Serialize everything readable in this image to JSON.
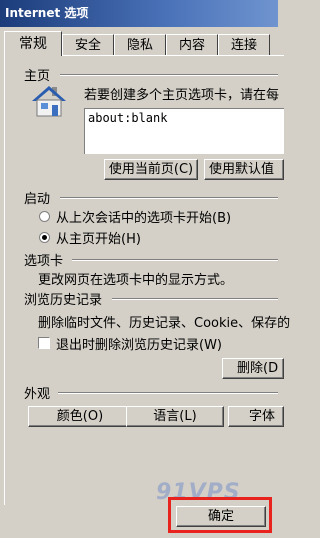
{
  "window": {
    "title": "Internet 选项"
  },
  "tabs": [
    {
      "label": "常规",
      "active": true
    },
    {
      "label": "安全",
      "active": false
    },
    {
      "label": "隐私",
      "active": false
    },
    {
      "label": "内容",
      "active": false
    },
    {
      "label": "连接",
      "active": false
    }
  ],
  "home": {
    "title": "主页",
    "description": "若要创建多个主页选项卡，请在每",
    "url_value": "about:blank",
    "use_current": "使用当前页(C)",
    "use_default": "使用默认值"
  },
  "startup": {
    "title": "启动",
    "option_last": "从上次会话中的选项卡开始(B)",
    "option_home": "从主页开始(H)",
    "selected": "option_home"
  },
  "tabs_section": {
    "title": "选项卡",
    "description": "更改网页在选项卡中的显示方式。"
  },
  "history": {
    "title": "浏览历史记录",
    "description": "删除临时文件、历史记录、Cookie、保存的",
    "delete_on_exit": "退出时删除浏览历史记录(W)",
    "delete_on_exit_checked": false,
    "delete_button": "删除(D"
  },
  "appearance": {
    "title": "外观",
    "colors": "颜色(O)",
    "languages": "语言(L)",
    "fonts": "字体"
  },
  "footer": {
    "ok": "确定",
    "watermark": "91VPS"
  },
  "colors": {
    "titlebar": "#1c3c7a",
    "highlight": "#e8231e",
    "face": "#d4d0c8"
  }
}
